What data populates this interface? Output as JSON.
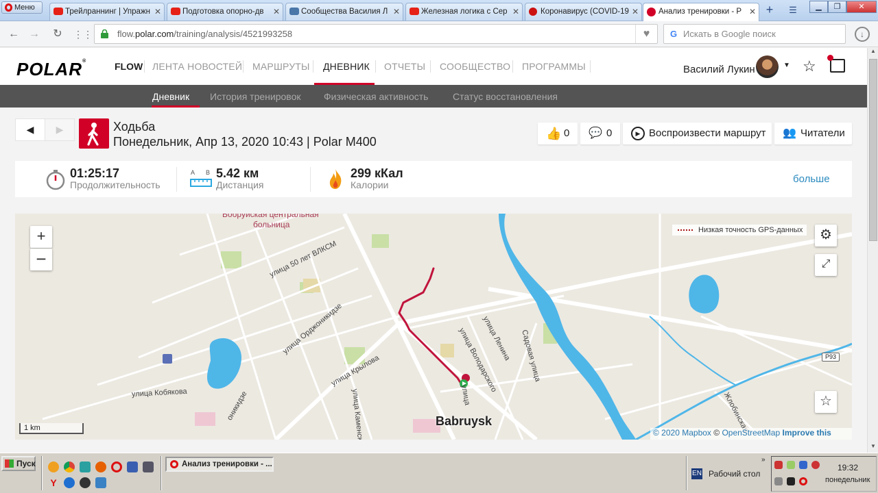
{
  "browser": {
    "menu_label": "Меню",
    "tabs": [
      {
        "label": "Трейлраннинг | Упражн",
        "icon": "youtube-icon",
        "color": "#e62117"
      },
      {
        "label": "Подготовка опорно-дв",
        "icon": "youtube-icon",
        "color": "#e62117"
      },
      {
        "label": "Сообщества Василия Л",
        "icon": "vk-icon",
        "color": "#4a76a8"
      },
      {
        "label": "Железная логика с Сер",
        "icon": "youtube-icon",
        "color": "#e62117"
      },
      {
        "label": "Коронавирус (COVID-19",
        "icon": "stop-icon",
        "color": "#cc1111"
      },
      {
        "label": "Анализ тренировки - Р",
        "icon": "polar-icon",
        "color": "#d10027"
      }
    ],
    "url_host": "flow.",
    "url_domain": "polar.com",
    "url_path": "/training/analysis/4521993258",
    "search_placeholder": "Искать в Google поиск"
  },
  "header": {
    "logo": "POLAR",
    "flow": "FLOW",
    "nav": [
      "ЛЕНТА НОВОСТЕЙ",
      "МАРШРУТЫ",
      "ДНЕВНИК",
      "ОТЧЕТЫ",
      "СООБЩЕСТВО",
      "ПРОГРАММЫ"
    ],
    "active_nav": "ДНЕВНИК",
    "user_name": "Василий Лукин"
  },
  "subnav": [
    "Дневник",
    "История тренировок",
    "Физическая активность",
    "Статус восстановления"
  ],
  "training": {
    "sport": "Ходьба",
    "meta": "Понедельник, Апр 13, 2020 10:43 | Polar M400",
    "likes": "0",
    "comments": "0",
    "replay_label": "Воспроизвести маршрут",
    "readers_label": "Читатели"
  },
  "summary": {
    "duration_value": "01:25:17",
    "duration_label": "Продолжительность",
    "distance_value": "5.42 км",
    "distance_label": "Дистанция",
    "calories_value": "299 кКал",
    "calories_label": "Калории",
    "more_label": "больше"
  },
  "map": {
    "gps_legend": "Низкая точность GPS-данных",
    "scale": "1 km",
    "city": "Babruysk",
    "road_badge": "P93",
    "labels": [
      {
        "text": "Бобруйская центральная",
        "name": "map-label-hospital-1"
      },
      {
        "text": "больница",
        "name": "map-label-hospital-2"
      },
      {
        "text": "улица 50 лет ВЛКСМ",
        "name": "map-label-street-vlksm"
      },
      {
        "text": "улица Орджоникидзе",
        "name": "map-label-street-ordzhonikidze"
      },
      {
        "text": "улица Крылова",
        "name": "map-label-street-krylova"
      },
      {
        "text": "улица Кобякова",
        "name": "map-label-street-kobyakova"
      },
      {
        "text": "улица Каменско",
        "name": "map-label-street-kamensko"
      },
      {
        "text": "улица Володарского",
        "name": "map-label-street-volodarskogo"
      },
      {
        "text": "улица Ленина",
        "name": "map-label-street-lenina"
      },
      {
        "text": "Садовая улица",
        "name": "map-label-street-sadovaya"
      },
      {
        "text": "Жлобинская",
        "name": "map-label-street-zhlobinskaya"
      },
      {
        "text": "улица",
        "name": "map-label-street-start"
      },
      {
        "text": "оникидзе",
        "name": "map-label-street-onikidze"
      }
    ],
    "attribution_year": "© 2020",
    "attribution_mapbox": "Mapbox",
    "attribution_osm": "OpenStreetMap",
    "attribution_improve": "Improve this map",
    "route_color": "#c0143c",
    "water_color": "#4fb6e8"
  },
  "taskbar": {
    "start_label": "Пуск",
    "task_label": "Анализ тренировки - ...",
    "lang": "EN",
    "desktop_label": "Рабочий стол",
    "time": "19:32",
    "day": "понедельник"
  }
}
